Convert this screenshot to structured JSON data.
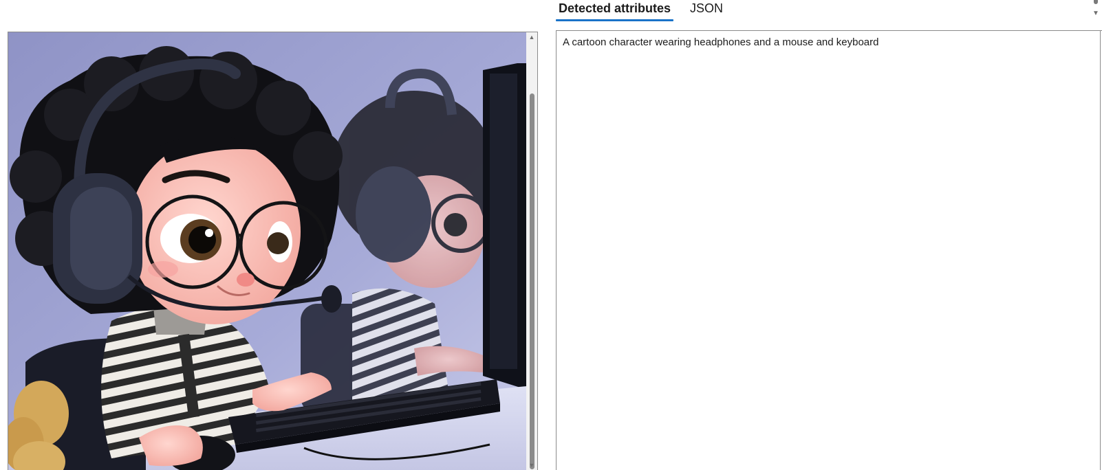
{
  "tabs": [
    {
      "label": "Detected attributes",
      "active": true
    },
    {
      "label": "JSON",
      "active": false
    }
  ],
  "output": {
    "caption": "A cartoon character wearing headphones and a mouse and keyboard"
  },
  "scrollbar": {
    "up_glyph": "▲",
    "down_glyph": "▼"
  },
  "colors": {
    "tab_underline": "#1a73c8",
    "border": "#8a8a8a",
    "scroll_thumb": "#8b8b8b"
  }
}
